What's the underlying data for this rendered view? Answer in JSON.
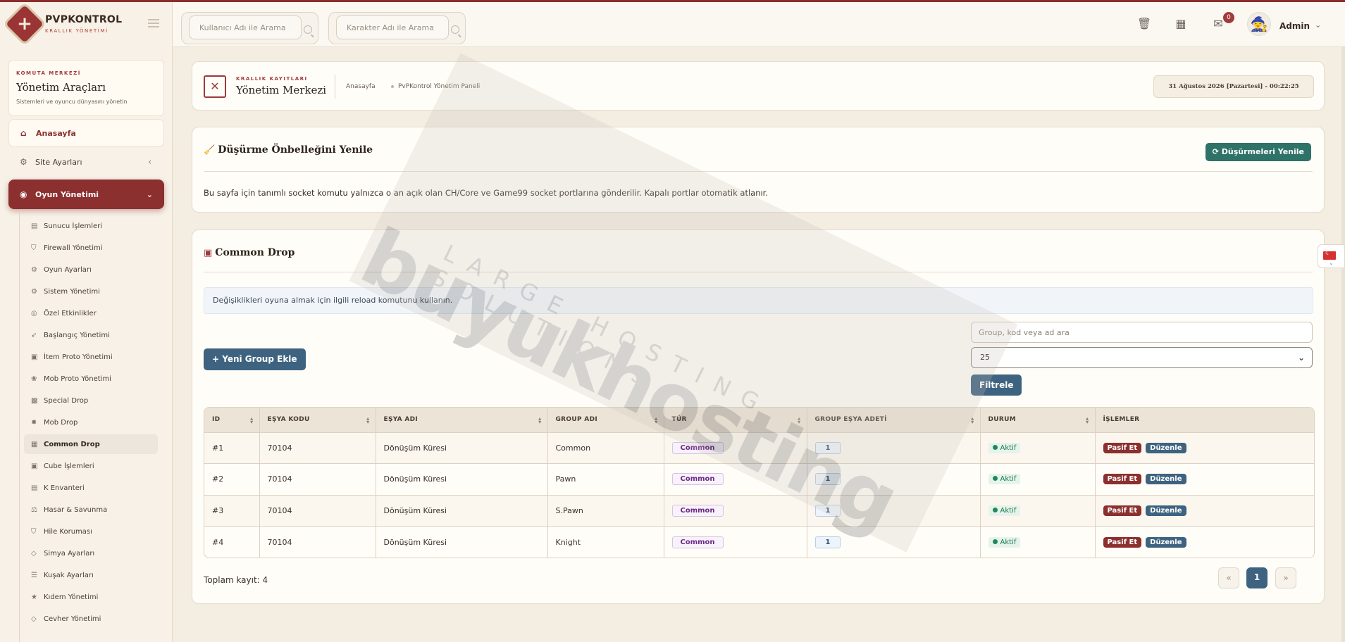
{
  "brand": {
    "name": "PVPKONTROL",
    "tagline": "KRALLIK YÖNETİMİ"
  },
  "header": {
    "search_user_placeholder": "Kullanıcı Adı ile Arama",
    "search_char_placeholder": "Karakter Adı ile Arama",
    "mail_count": "0",
    "user_name": "Admin"
  },
  "sidebar": {
    "card_tag": "KOMUTA MERKEZİ",
    "card_title": "Yönetim Araçları",
    "card_desc": "Sistemleri ve oyuncu dünyasını yönetin",
    "home": "Anasayfa",
    "site_settings": "Site Ayarları",
    "game_management": "Oyun Yönetimi",
    "sub_items": [
      "Sunucu İşlemleri",
      "Firewall Yönetimi",
      "Oyun Ayarları",
      "Sistem Yönetimi",
      "Özel Etkinlikler",
      "Başlangıç Yönetimi",
      "İtem Proto Yönetimi",
      "Mob Proto Yönetimi",
      "Special Drop",
      "Mob Drop",
      "Common Drop",
      "Cube İşlemleri",
      "K Envanteri",
      "Hasar & Savunma",
      "Hile Koruması",
      "Simya Ayarları",
      "Kuşak Ayarları",
      "Kıdem Yönetimi",
      "Cevher Yönetimi"
    ]
  },
  "breadcrumb": {
    "tag": "KRALLIK KAYITLARI",
    "title": "Yönetim Merkezi",
    "home": "Anasayfa",
    "page": "PvPKontrol Yönetim Paneli",
    "datetime": "31 Ağustos 2026 [Pazartesi] - 00:22:25"
  },
  "refresh_card": {
    "title": "Düşürme Önbelleğini Yenile",
    "button": "Düşürmeleri Yenile",
    "description": "Bu sayfa için tanımlı socket komutu yalnızca o an açık olan CH/Core ve Game99 socket portlarına gönderilir. Kapalı portlar otomatik atlanır."
  },
  "drop_card": {
    "title": "Common Drop",
    "info": "Değişiklikleri oyuna almak için ilgili reload komutunu kullanın.",
    "new_button": "Yeni Group Ekle",
    "search_placeholder": "Group, kod veya ad ara",
    "page_size": "25",
    "filter_button": "Filtrele",
    "columns": [
      "ID",
      "EŞYA KODU",
      "EŞYA ADI",
      "GROUP ADI",
      "TÜR",
      "GROUP EŞYA ADETİ",
      "DURUM",
      "İŞLEMLER"
    ],
    "rows": [
      {
        "id": "#1",
        "code": "70104",
        "name": "Dönüşüm Küresi",
        "group": "Common",
        "type": "Common",
        "count": "1",
        "status": "Aktif"
      },
      {
        "id": "#2",
        "code": "70104",
        "name": "Dönüşüm Küresi",
        "group": "Pawn",
        "type": "Common",
        "count": "1",
        "status": "Aktif"
      },
      {
        "id": "#3",
        "code": "70104",
        "name": "Dönüşüm Küresi",
        "group": "S.Pawn",
        "type": "Common",
        "count": "1",
        "status": "Aktif"
      },
      {
        "id": "#4",
        "code": "70104",
        "name": "Dönüşüm Küresi",
        "group": "Knight",
        "type": "Common",
        "count": "1",
        "status": "Aktif"
      }
    ],
    "action_passive": "Pasif Et",
    "action_edit": "Düzenle",
    "total": "Toplam kayıt: 4",
    "pagination": {
      "prev": "«",
      "current": "1",
      "next": "»"
    }
  },
  "watermark": {
    "main": "buyukhosting",
    "sub": "LARGE HOSTING SOLUTIONS"
  },
  "colors": {
    "primary": "#8b2f2f",
    "secondary": "#3e6380",
    "success": "#2e7268"
  }
}
